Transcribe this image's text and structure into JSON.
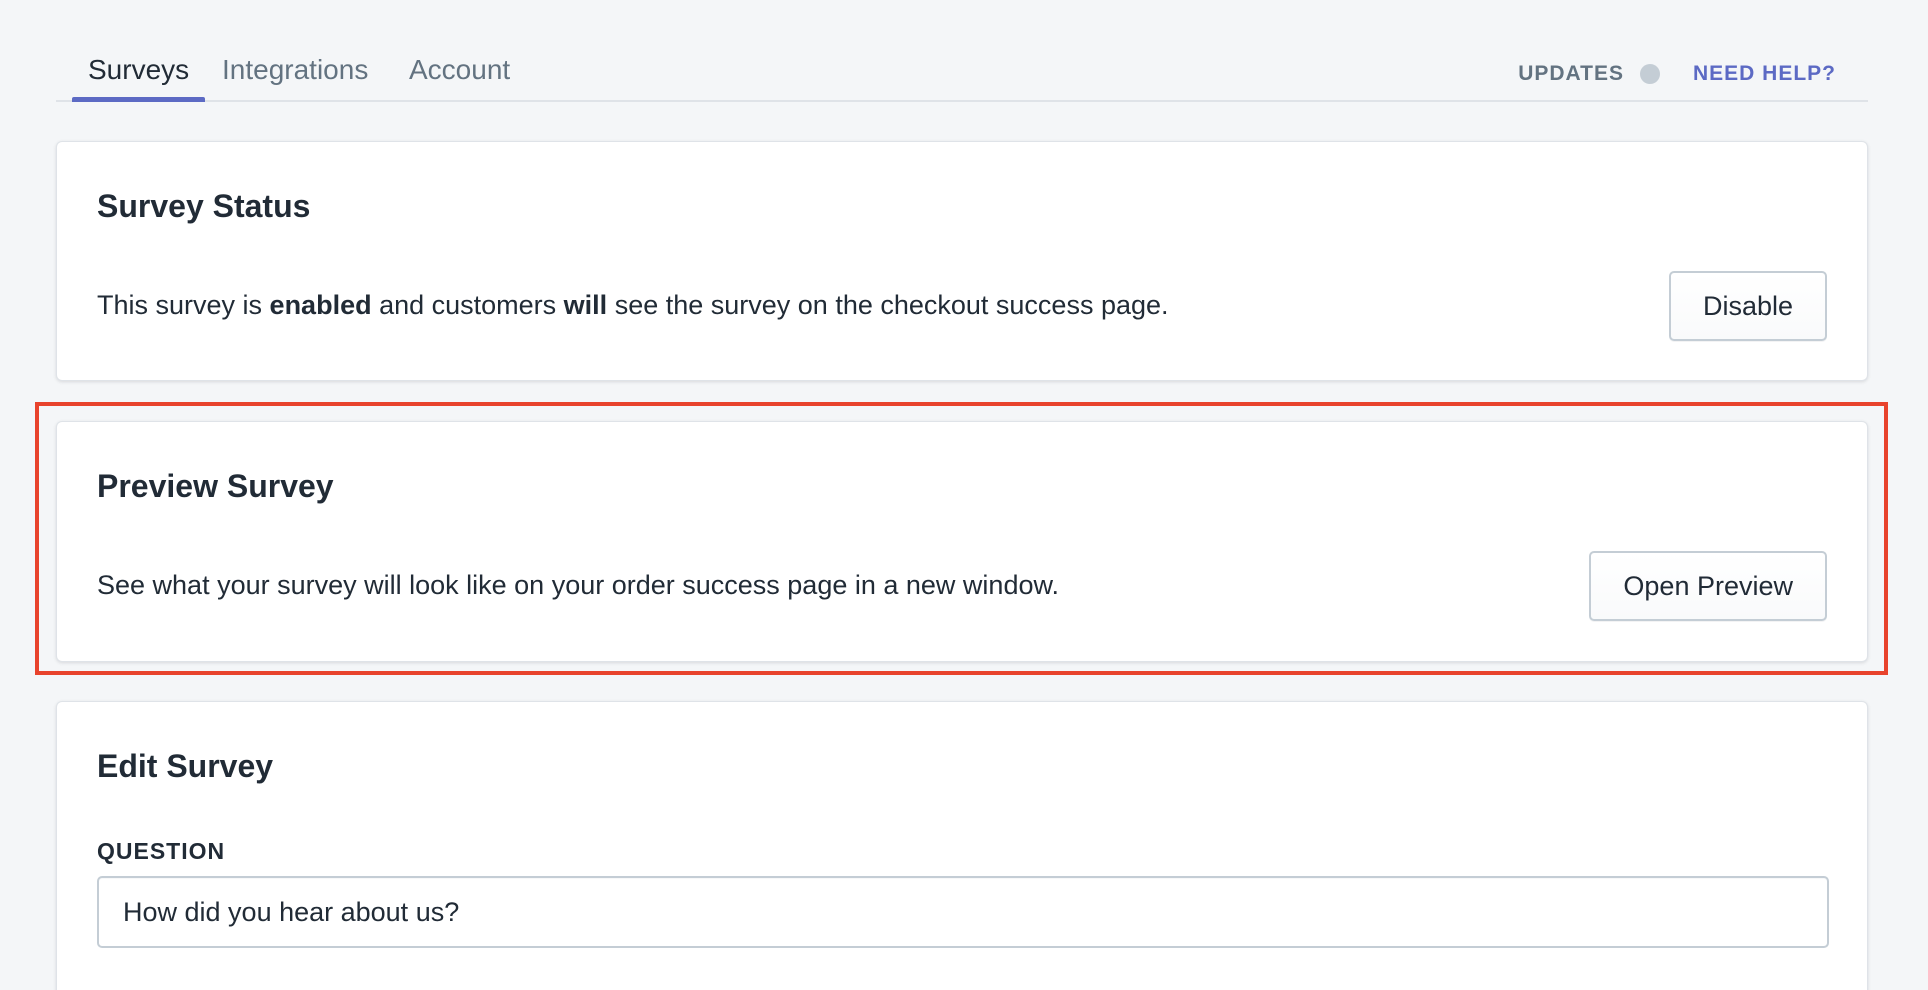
{
  "nav": {
    "tabs": [
      {
        "label": "Surveys",
        "active": true
      },
      {
        "label": "Integrations",
        "active": false
      },
      {
        "label": "Account",
        "active": false
      }
    ],
    "updates_label": "UPDATES",
    "help_label": "NEED HELP?"
  },
  "status_card": {
    "title": "Survey Status",
    "text_1": "This survey is ",
    "text_bold_1": "enabled",
    "text_2": " and customers ",
    "text_bold_2": "will",
    "text_3": " see the survey on the checkout success page.",
    "button_label": "Disable"
  },
  "preview_card": {
    "title": "Preview Survey",
    "description": "See what your survey will look like on your order success page in a new window.",
    "button_label": "Open Preview"
  },
  "edit_card": {
    "title": "Edit Survey",
    "question_label": "QUESTION",
    "question_value": "How did you hear about us?"
  },
  "colors": {
    "accent": "#5c6ac4",
    "highlight": "#e8432d",
    "background": "#f4f6f8"
  }
}
